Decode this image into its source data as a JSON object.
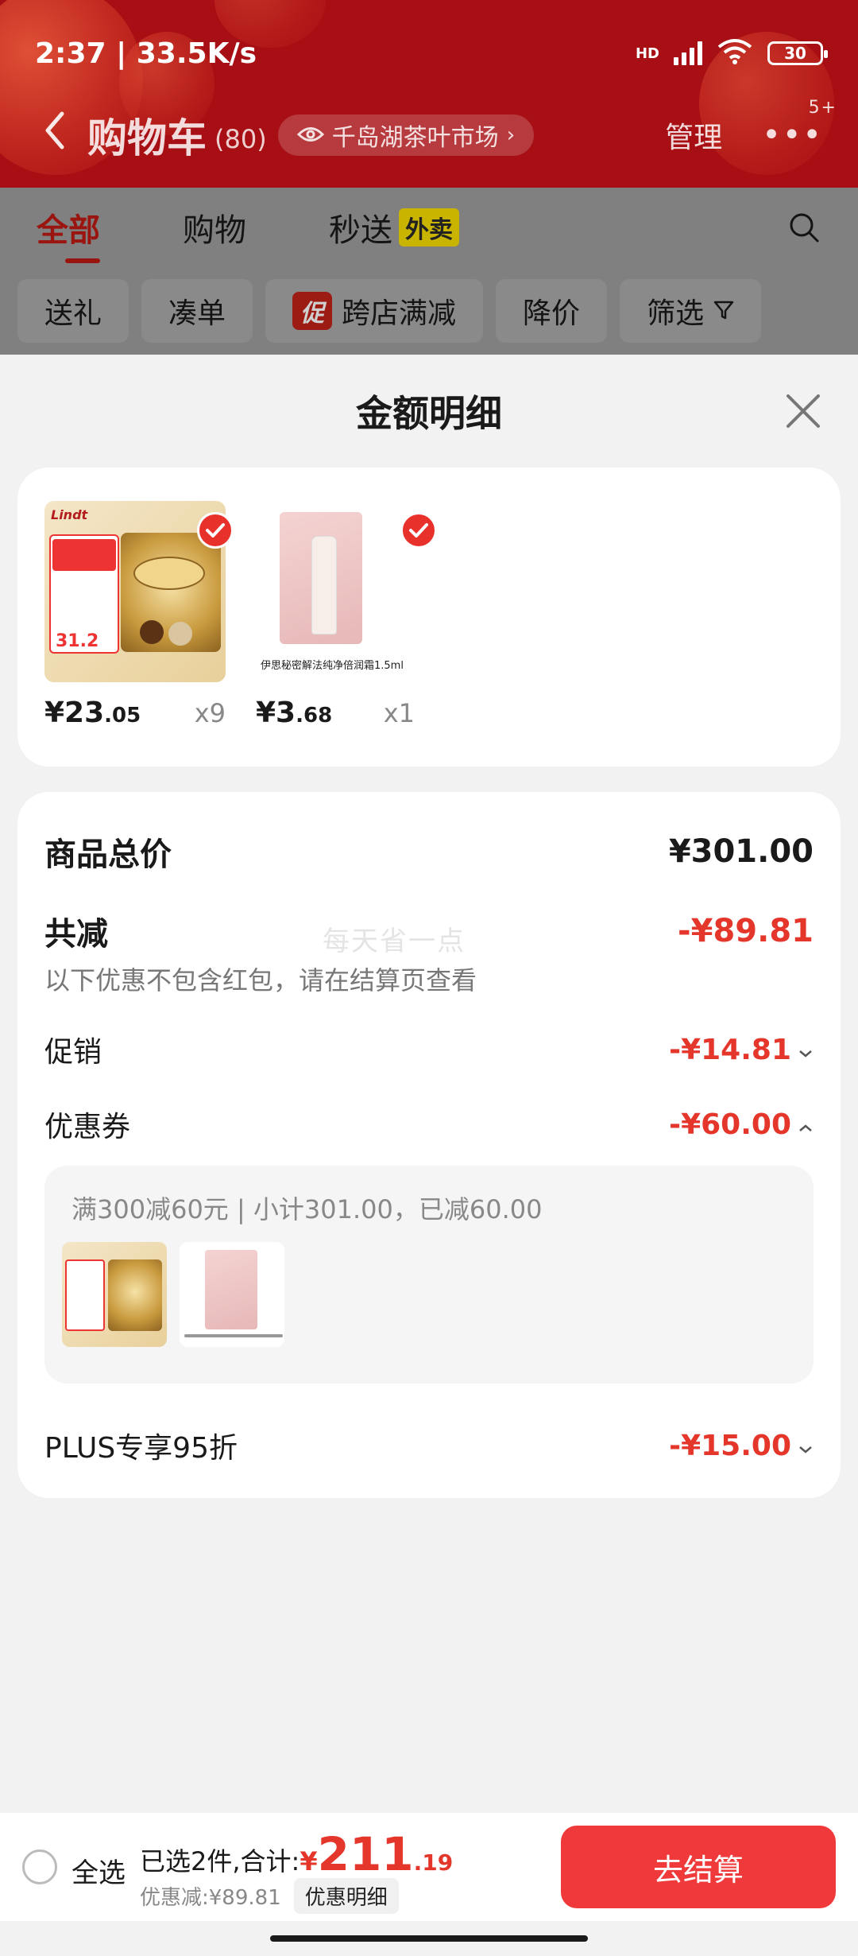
{
  "status": {
    "time_speed": "2:37 | 33.5K/s",
    "hd": "HD",
    "wifi_num": "6",
    "battery": "30"
  },
  "nav": {
    "title": "购物车",
    "count": "(80)",
    "location": "千岛湖茶叶市场",
    "manage": "管理",
    "more_badge": "5+"
  },
  "tabs": [
    {
      "label": "全部"
    },
    {
      "label": "购物"
    },
    {
      "label": "秒送",
      "tag": "外卖"
    }
  ],
  "chips": [
    {
      "label": "送礼"
    },
    {
      "label": "凑单"
    },
    {
      "label": "跨店满减",
      "badge": "促"
    },
    {
      "label": "降价"
    },
    {
      "label": "筛选"
    }
  ],
  "sheet": {
    "title": "金额明细",
    "products": [
      {
        "name": "瑞士莲",
        "price_int": "¥23",
        "price_dec": ".05",
        "qty": "x9"
      },
      {
        "name": "伊思秘密解法纯净倍润霜1.5ml",
        "price_int": "¥3",
        "price_dec": ".68",
        "qty": "x1"
      }
    ],
    "summary": {
      "total_label": "商品总价",
      "total_value": "¥301.00",
      "reduce_label": "共减",
      "reduce_value": "-¥89.81",
      "watermark": "每天省一点",
      "hint": "以下优惠不包含红包，请在结算页查看",
      "promo_label": "促销",
      "promo_value": "-¥14.81",
      "coupon_label": "优惠券",
      "coupon_value": "-¥60.00",
      "coupon_detail": "满300减60元 | 小计301.00，已减60.00",
      "plus_label": "PLUS专享95折",
      "plus_value": "-¥15.00"
    }
  },
  "bottom": {
    "select_all": "全选",
    "selected": "已选2件,合计:",
    "currency": "¥",
    "total_int": "211",
    "total_dec": ".19",
    "discount": "优惠减:¥89.81",
    "detail_btn": "优惠明细",
    "checkout": "去结算"
  },
  "colors": {
    "header": "#a70f14",
    "accent_red": "#e5362b",
    "checkout": "#f0393a"
  }
}
